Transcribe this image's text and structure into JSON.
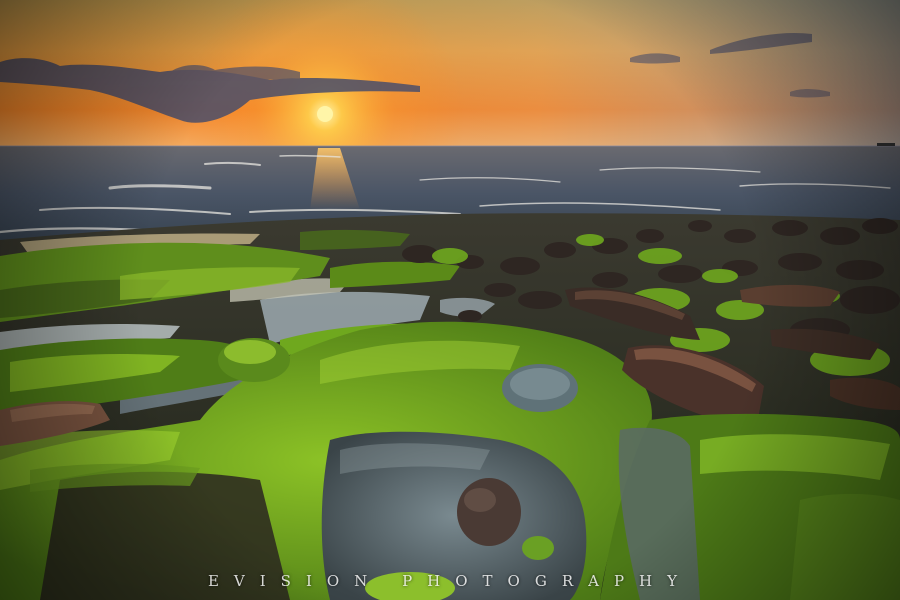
{
  "photo": {
    "subject": "sunset over sea with moss-covered rocky shore and tide pools",
    "colors": {
      "sky_top": "#e8a24a",
      "sky_horizon": "#ff7a1a",
      "sun": "#fff3a0",
      "sea": "#3b4a5a",
      "moss": "#6fa81e",
      "rock": "#3a2e28"
    }
  },
  "watermark": {
    "text": "EVISION PHOTOGRAPHY"
  }
}
